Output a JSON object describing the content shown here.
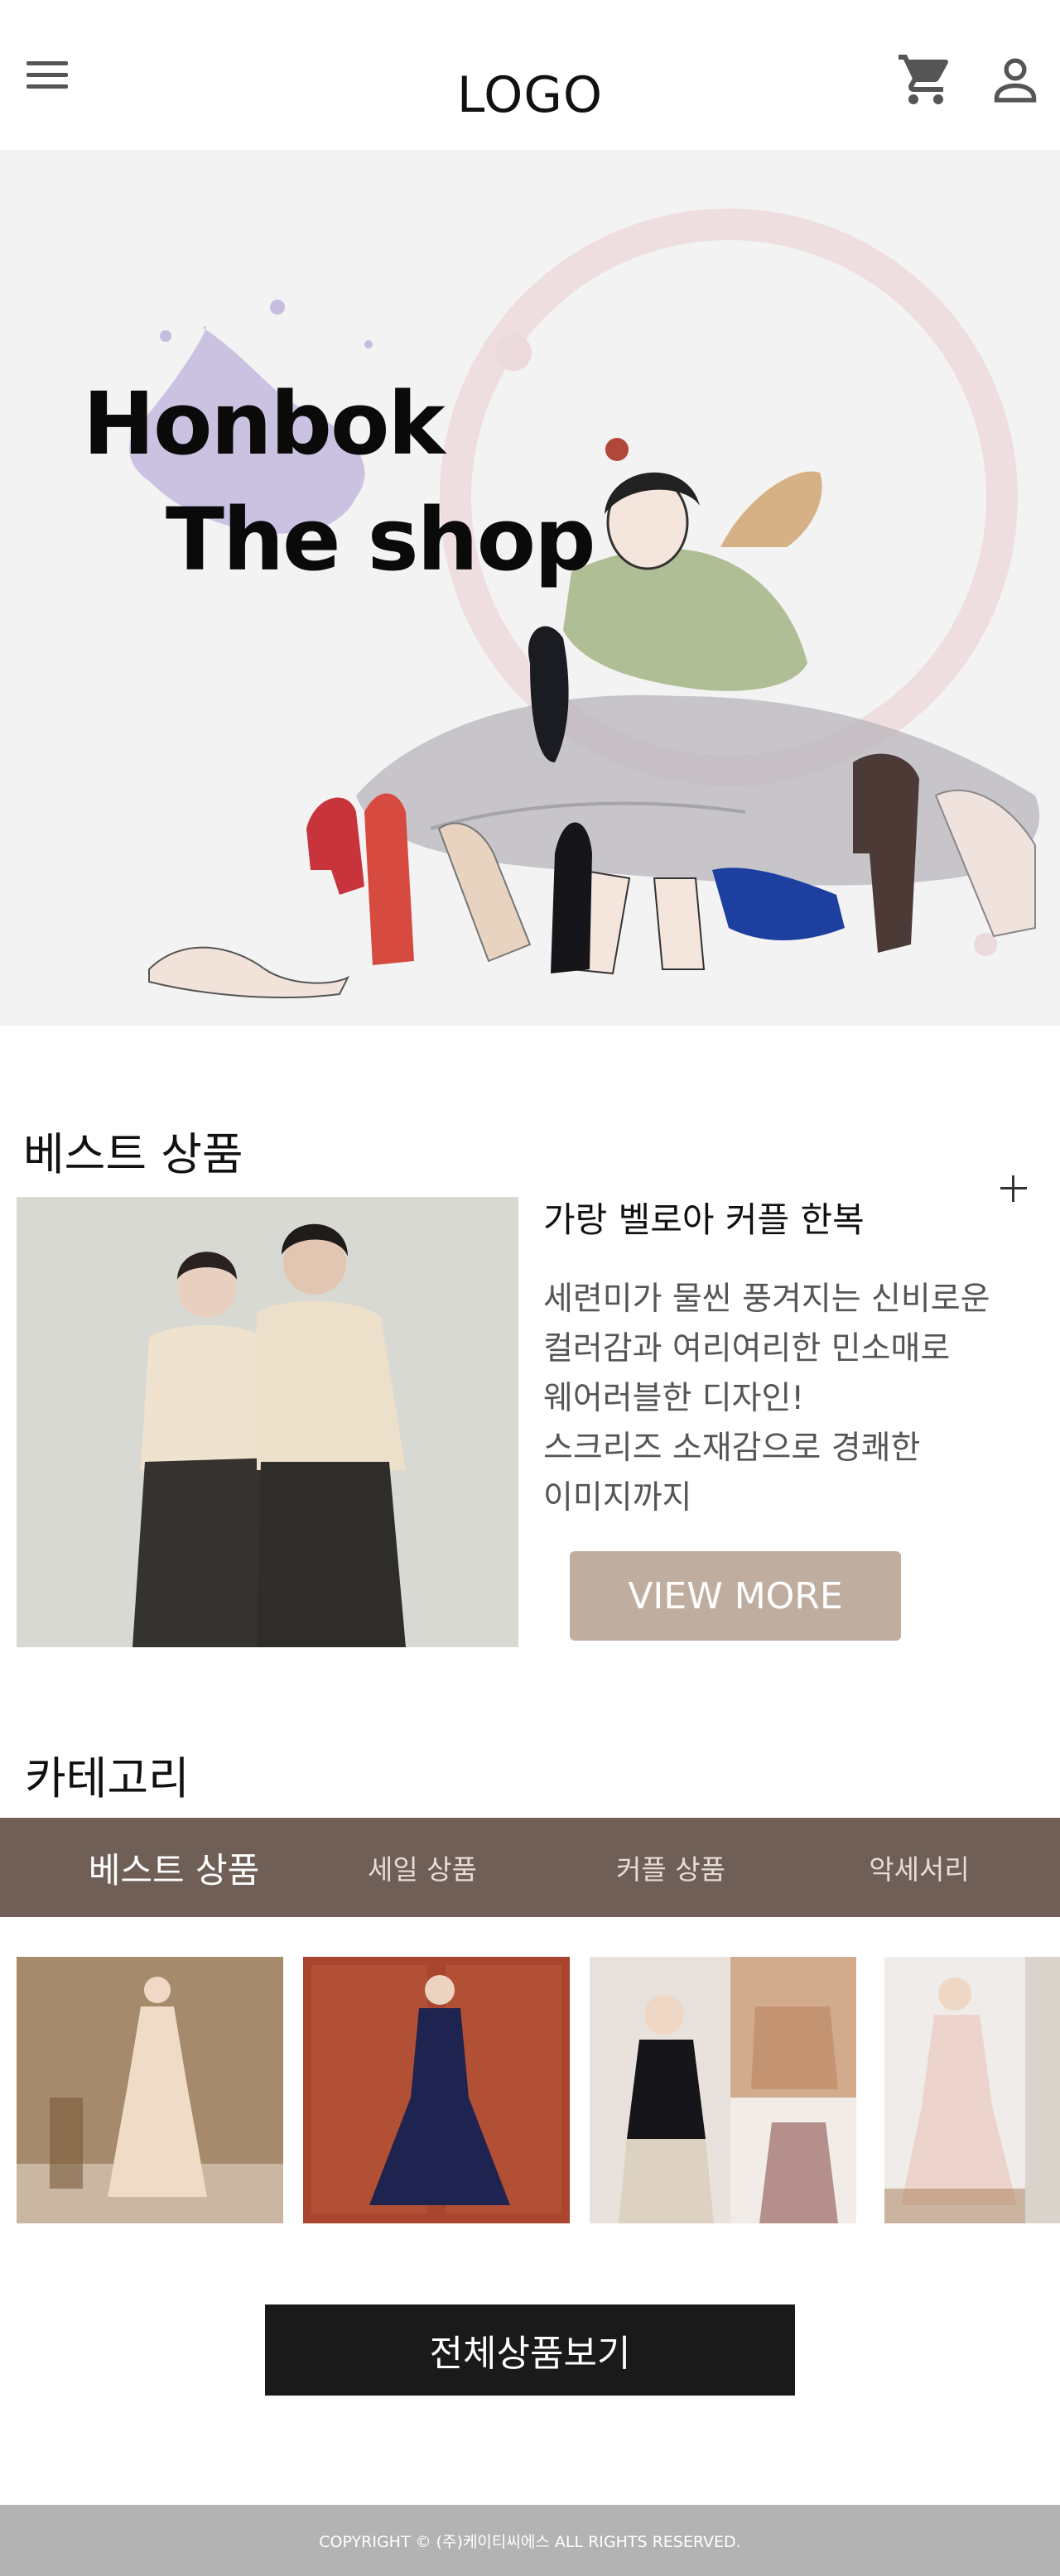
{
  "header": {
    "logo": "LOGO",
    "menu_icon": "hamburger-menu-icon",
    "cart_icon": "cart-icon",
    "user_icon": "user-icon"
  },
  "hero": {
    "title_line1": "Honbok",
    "title_line2": "The shop"
  },
  "best": {
    "section_title": "베스트 상품",
    "product_name": "가랑 벨로아 커플 한복",
    "description_lines": [
      "세련미가 물씬 풍겨지는 신비로운",
      "컬러감과 여리여리한 민소매로",
      "웨어러블한 디자인!",
      "스크리즈 소재감으로 경쾌한",
      "이미지까지"
    ],
    "view_more": "VIEW MORE",
    "plus_icon": "plus-icon"
  },
  "category": {
    "section_title": "카테고리",
    "tabs": [
      "베스트 상품",
      "세일 상품",
      "커플 상품",
      "악세서리"
    ],
    "active_tab": 0
  },
  "all_products_button": "전체상품보기",
  "footer": {
    "copyright": "COPYRIGHT © (주)케이티씨에스 ALL RIGHTS RESERVED."
  },
  "colors": {
    "tab_bar": "#6f5f57",
    "view_more_button": "#bfada0",
    "all_button": "#1a1a1a",
    "footer": "#b3b3b3"
  }
}
